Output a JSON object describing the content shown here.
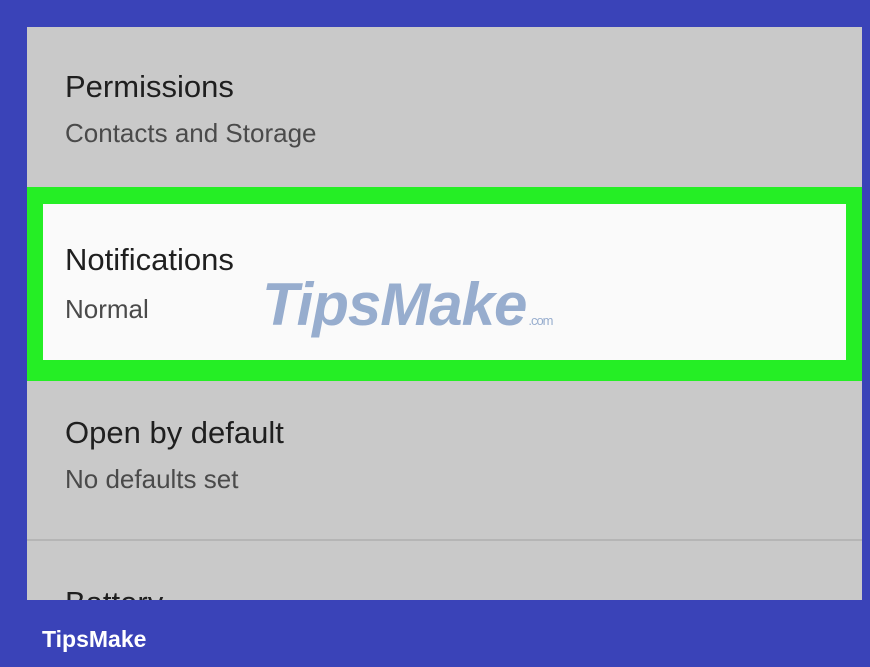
{
  "settings": {
    "permissions": {
      "title": "Permissions",
      "subtitle": "Contacts and Storage"
    },
    "notifications": {
      "title": "Notifications",
      "subtitle": "Normal",
      "highlight_color": "#25ee25"
    },
    "open_by_default": {
      "title": "Open by default",
      "subtitle": "No defaults set"
    },
    "battery": {
      "title": "Battery"
    }
  },
  "watermark": {
    "text": "TipsMake",
    "suffix": ".com"
  },
  "footer": {
    "brand": "TipsMake"
  },
  "colors": {
    "frame": "#3a43b8",
    "list_background": "#c9c9c9",
    "selected_background": "#fafafa"
  }
}
